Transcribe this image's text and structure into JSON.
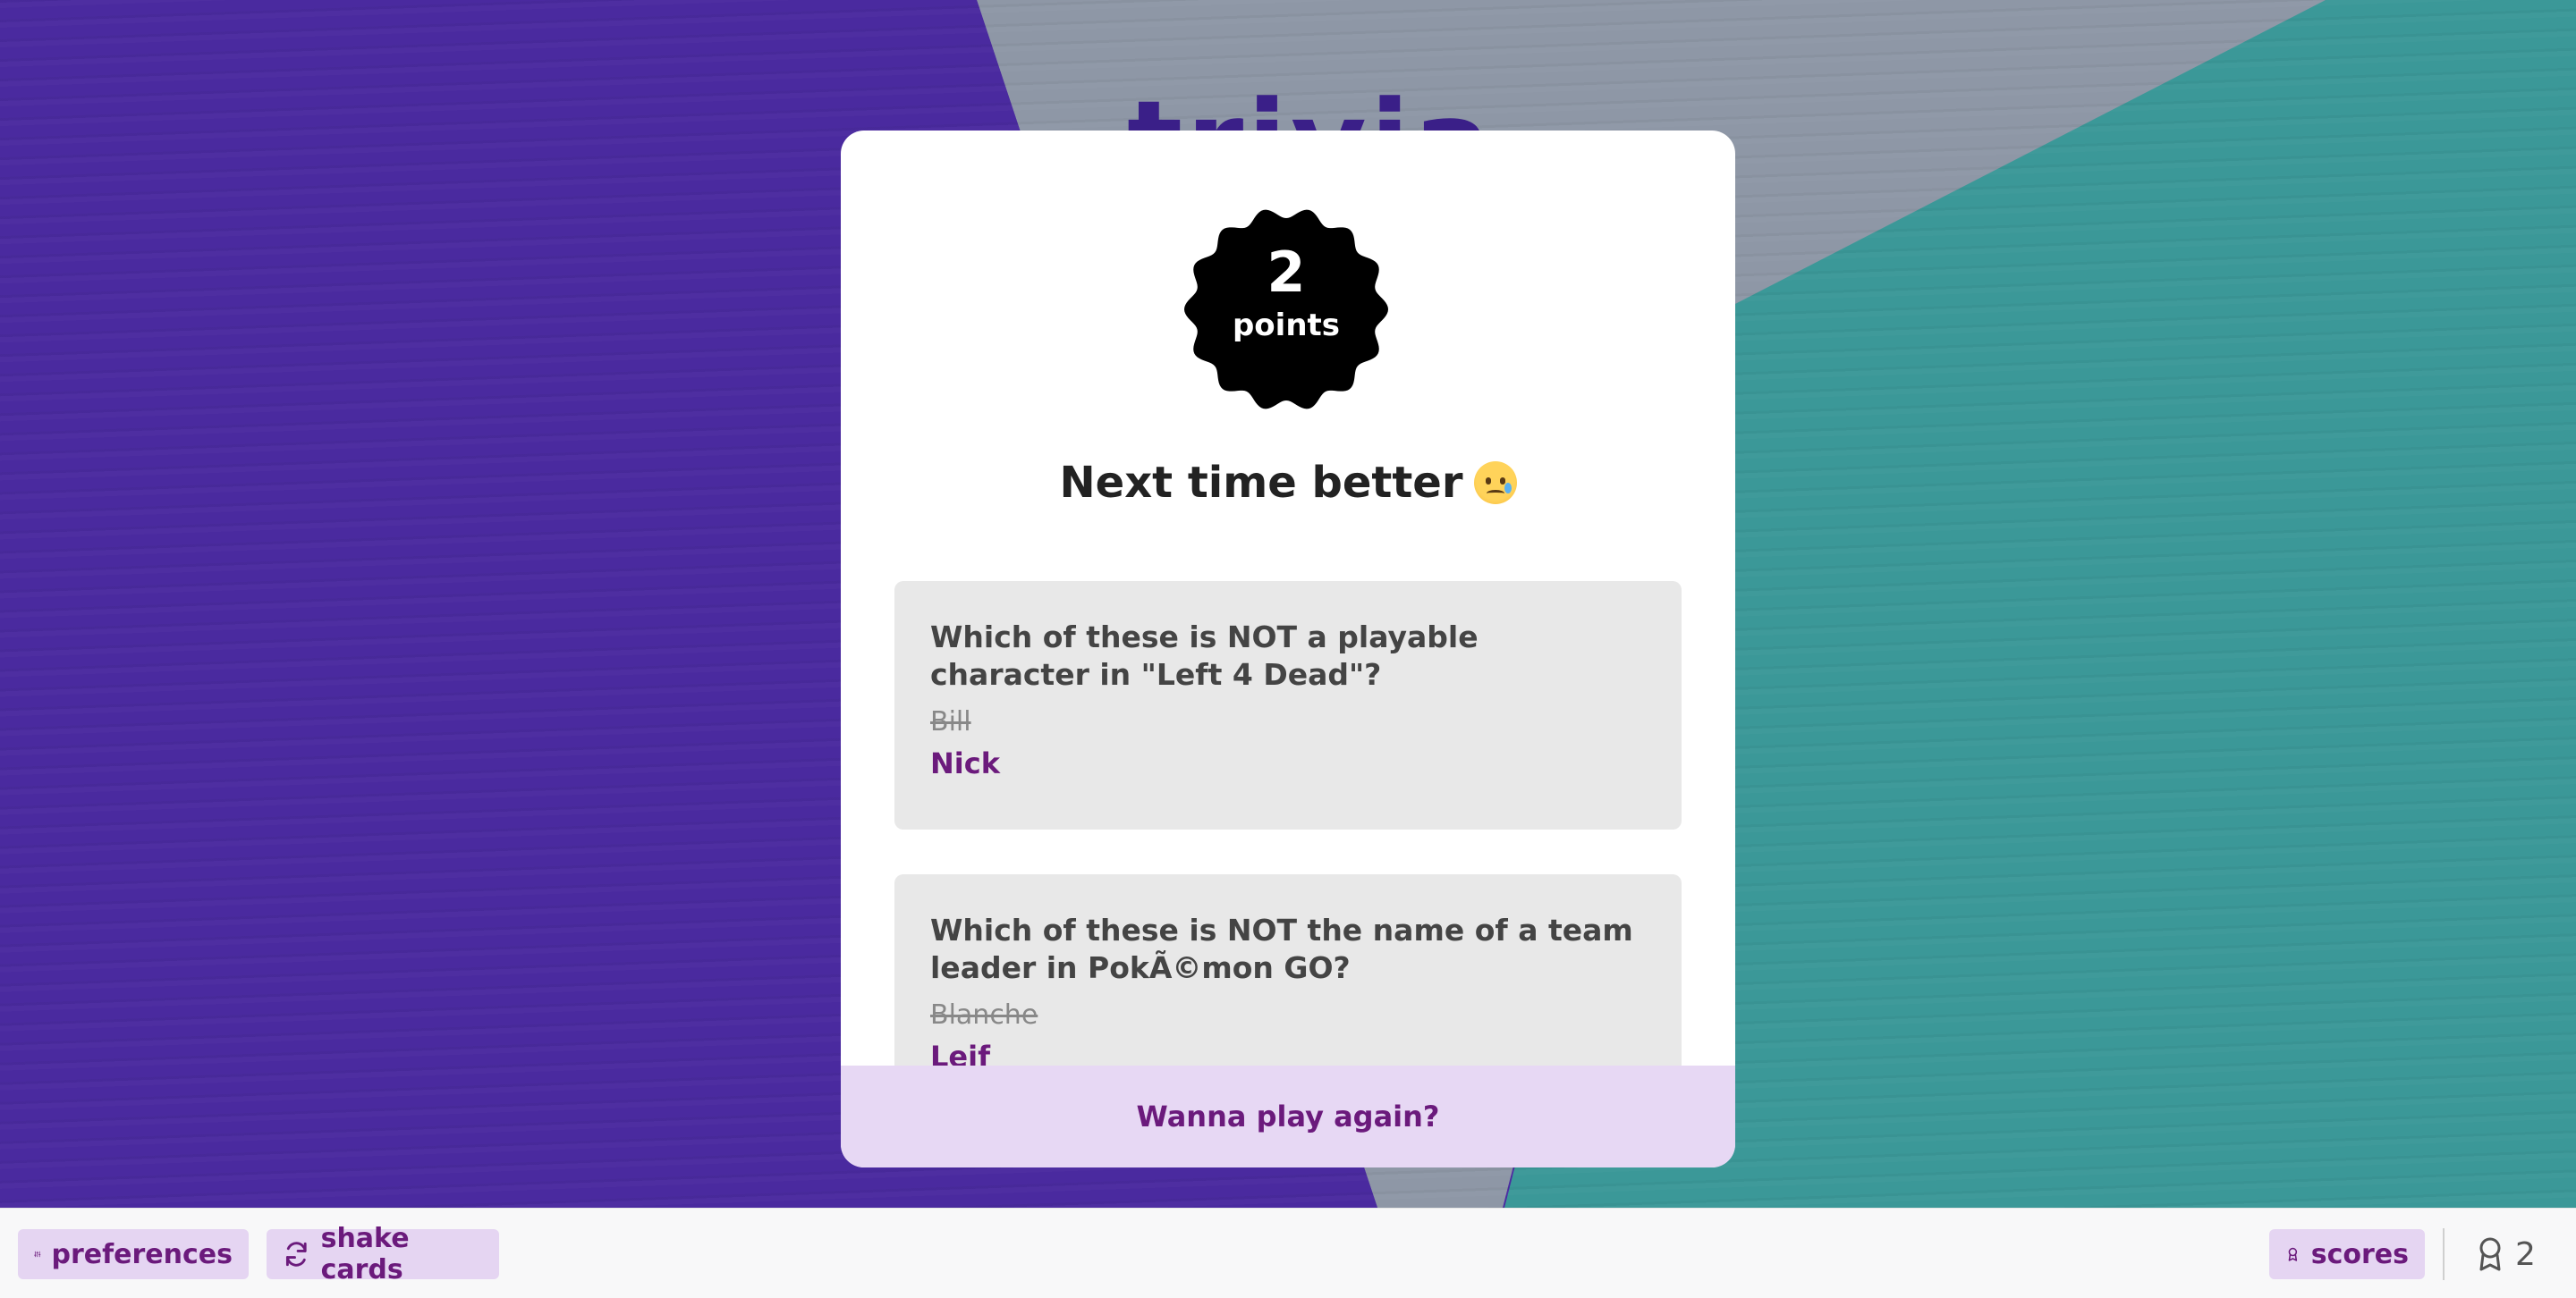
{
  "background": {
    "logo_text": "trivia",
    "colors": {
      "purple": "#4b2ba0",
      "grey": "#8e97a6",
      "teal": "#3b9898"
    }
  },
  "result": {
    "points_value": "2",
    "points_label": "points",
    "message": "Next time better",
    "emoji_icon": "sad-but-relieved-face-icon"
  },
  "questions": [
    {
      "text": "Which of these is NOT a playable character in \"Left 4 Dead\"?",
      "selected_answer": "Bill",
      "correct_answer": "Nick"
    },
    {
      "text": "Which of these is NOT the name of a team leader in PokÃ©mon GO?",
      "selected_answer": "Blanche",
      "correct_answer": "Leif"
    }
  ],
  "actions": {
    "play_again": "Wanna play again?"
  },
  "toolbar": {
    "preferences_label": "preferences",
    "preferences_icon": "sliders-icon",
    "shake_label": "shake cards",
    "shake_icon": "refresh-icon",
    "scores_label": "scores",
    "scores_icon": "award-icon",
    "score_count": "2"
  },
  "colors": {
    "accent": "#6b1a7c",
    "accent_bg": "#e5d5f2",
    "badge_bg": "#000000"
  }
}
